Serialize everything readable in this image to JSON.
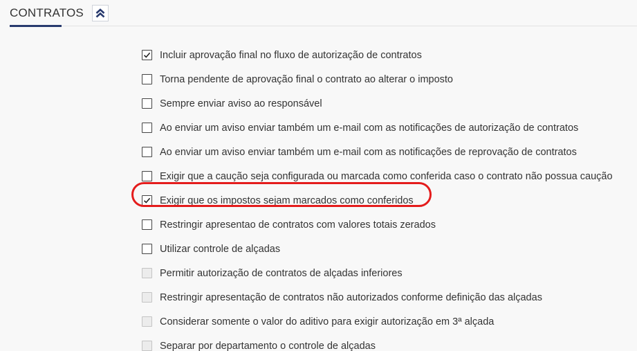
{
  "section": {
    "title": "CONTRATOS",
    "collapse_icon": "double-chevron-up-icon",
    "accent_color": "#283a6e"
  },
  "highlight": {
    "color": "#e41c1c",
    "target_option_index": 6
  },
  "options": [
    {
      "label": "Incluir aprovação final no fluxo de autorização de contratos",
      "checked": true,
      "enabled": true
    },
    {
      "label": "Torna pendente de aprovação final o contrato ao alterar o imposto",
      "checked": false,
      "enabled": true
    },
    {
      "label": "Sempre enviar aviso ao responsável",
      "checked": false,
      "enabled": true
    },
    {
      "label": "Ao enviar um aviso enviar também um e-mail com as notificações de autorização de contratos",
      "checked": false,
      "enabled": true
    },
    {
      "label": "Ao enviar um aviso enviar também um e-mail com as notificações de reprovação de contratos",
      "checked": false,
      "enabled": true
    },
    {
      "label": "Exigir que a caução seja configurada ou marcada como conferida caso o contrato não possua caução",
      "checked": false,
      "enabled": true
    },
    {
      "label": "Exigir que os impostos sejam marcados como conferidos",
      "checked": true,
      "enabled": true
    },
    {
      "label": "Restringir apresentao de contratos com valores totais zerados",
      "checked": false,
      "enabled": true
    },
    {
      "label": "Utilizar controle de alçadas",
      "checked": false,
      "enabled": true
    },
    {
      "label": "Permitir autorização de contratos de alçadas inferiores",
      "checked": false,
      "enabled": false
    },
    {
      "label": "Restringir apresentação de contratos não autorizados conforme definição das alçadas",
      "checked": false,
      "enabled": false
    },
    {
      "label": "Considerar somente o valor do aditivo para exigir autorização em 3ª alçada",
      "checked": false,
      "enabled": false
    },
    {
      "label": "Separar por departamento o controle de alçadas",
      "checked": false,
      "enabled": false
    }
  ]
}
